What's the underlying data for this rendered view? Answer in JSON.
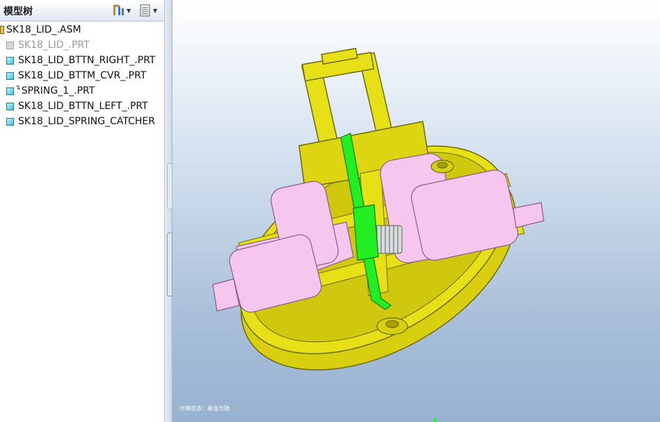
{
  "tree": {
    "title": "模型树",
    "settings_icon": "tree-settings-icon",
    "show_icon": "tree-show-icon",
    "items": [
      {
        "label": "SK18_LID_.ASM",
        "type": "assembly"
      },
      {
        "label": "SK18_LID_.PRT",
        "type": "part",
        "state": "suppressed"
      },
      {
        "label": "SK18_LID_BTTN_RIGHT_.PRT",
        "type": "part"
      },
      {
        "label": "SK18_LID_BTTM_CVR_.PRT",
        "type": "part"
      },
      {
        "label": "SPRING_1_.PRT",
        "type": "part",
        "mark": "flexible"
      },
      {
        "label": "SK18_LID_BTTN_LEFT_.PRT",
        "type": "part"
      },
      {
        "label": "SK18_LID_SPRING_CATCHER",
        "type": "part"
      }
    ]
  },
  "viewport": {
    "status_message": "分离状态：被当为隐"
  },
  "colors": {
    "housing": "#e8e016",
    "buttons": "#f6c6ee",
    "catcher": "#22ee22",
    "spring": "#d8dcdc",
    "background_top": "#ffffff",
    "background_bottom": "#98b2d1"
  }
}
